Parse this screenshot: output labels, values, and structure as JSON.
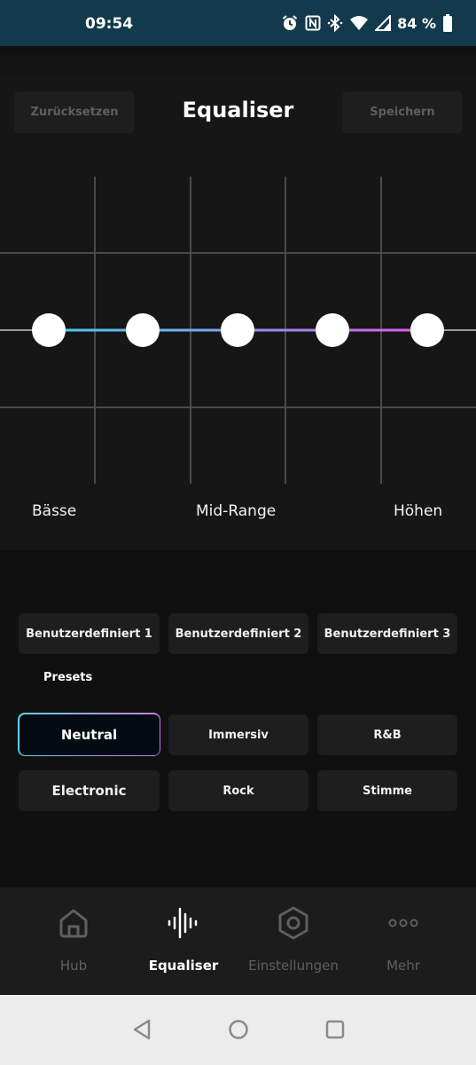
{
  "status_bar": {
    "time": "09:54",
    "battery": "84 %",
    "icons": [
      "alarm-icon",
      "nfc-icon",
      "bluetooth-icon",
      "wifi-icon",
      "signal-icon",
      "battery-icon"
    ]
  },
  "header": {
    "title": "Equaliser",
    "reset_label": "Zurücksetzen",
    "save_label": "Speichern"
  },
  "equalizer": {
    "band_levels": [
      0,
      0,
      0,
      0,
      0
    ],
    "gradient_colors": [
      "#4ec9f0",
      "#7b8cf0",
      "#c970f0",
      "#e45ce6"
    ],
    "labels": {
      "bass": "Bässe",
      "mid": "Mid-Range",
      "treble": "Höhen"
    }
  },
  "custom_presets": [
    "Benutzerdefiniert 1",
    "Benutzerdefiniert 2",
    "Benutzerdefiniert 3"
  ],
  "presets": {
    "heading": "Presets",
    "items": [
      "Neutral",
      "Immersiv",
      "R&B",
      "Electronic",
      "Rock",
      "Stimme"
    ],
    "selected": "Neutral"
  },
  "nav": {
    "items": [
      {
        "label": "Hub",
        "icon": "home-icon"
      },
      {
        "label": "Equaliser",
        "icon": "equalizer-icon"
      },
      {
        "label": "Einstellungen",
        "icon": "settings-icon"
      },
      {
        "label": "Mehr",
        "icon": "more-icon"
      }
    ],
    "active": "Equaliser"
  },
  "system_nav": [
    "back-icon",
    "home-circle-icon",
    "recents-icon"
  ],
  "colors": {
    "accent_start": "#5fd0e6",
    "accent_end": "#c97bf0",
    "status_bar": "#133a4c"
  }
}
